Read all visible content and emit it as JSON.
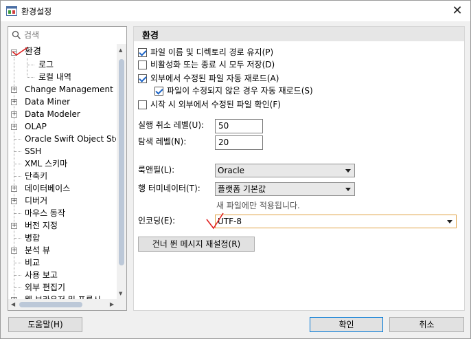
{
  "window": {
    "title": "환경설정",
    "close_glyph": "✕",
    "icon": "preferences-app-icon"
  },
  "search": {
    "placeholder": "검색",
    "icon": "search-icon"
  },
  "tree": {
    "root": "환경",
    "children": [
      "로그",
      "로컬 내역"
    ],
    "items": [
      "Change Management D",
      "Data Miner",
      "Data Modeler",
      "OLAP",
      "Oracle Swift Object Sto",
      "SSH",
      "XML 스키마",
      "단축키",
      "데이터베이스",
      "디버거",
      "마우스 동작",
      "버전 지정",
      "병합",
      "분석 뷰",
      "비교",
      "사용 보고",
      "외부 편집기",
      "웹 브라우저 및 프록시"
    ]
  },
  "panel": {
    "title": "환경",
    "checkboxes": [
      {
        "label": "파일 이름 및 디렉토리 경로 유지(P)",
        "checked": true
      },
      {
        "label": "비활성화 또는 종료 시 모두 저장(D)",
        "checked": false
      },
      {
        "label": "외부에서 수정된 파일 자동 재로드(A)",
        "checked": true
      },
      {
        "label": "파일이 수정되지 않은 경우 자동 재로드(S)",
        "checked": true
      },
      {
        "label": "시작 시 외부에서 수정된 파일 확인(F)",
        "checked": false
      }
    ],
    "undo_level_label": "실행 취소 레벨(U):",
    "undo_level_value": "50",
    "nav_level_label": "탐색 레벨(N):",
    "nav_level_value": "20",
    "look_feel_label": "룩앤필(L):",
    "look_feel_value": "Oracle",
    "line_term_label": "행 터미네이터(T):",
    "line_term_value": "플랫폼 기본값",
    "line_term_hint": "새 파일에만 적용됩니다.",
    "encoding_label": "인코딩(E):",
    "encoding_value": "UTF-8",
    "reset_skipped_label": "건너 뛴 메시지 재설정(R)"
  },
  "footer": {
    "help_label": "도움말(H)",
    "ok_label": "확인",
    "cancel_label": "취소"
  },
  "colors": {
    "checkmark": "#1b63c6",
    "annotation": "#e02020",
    "focus_border": "#e0a040"
  }
}
